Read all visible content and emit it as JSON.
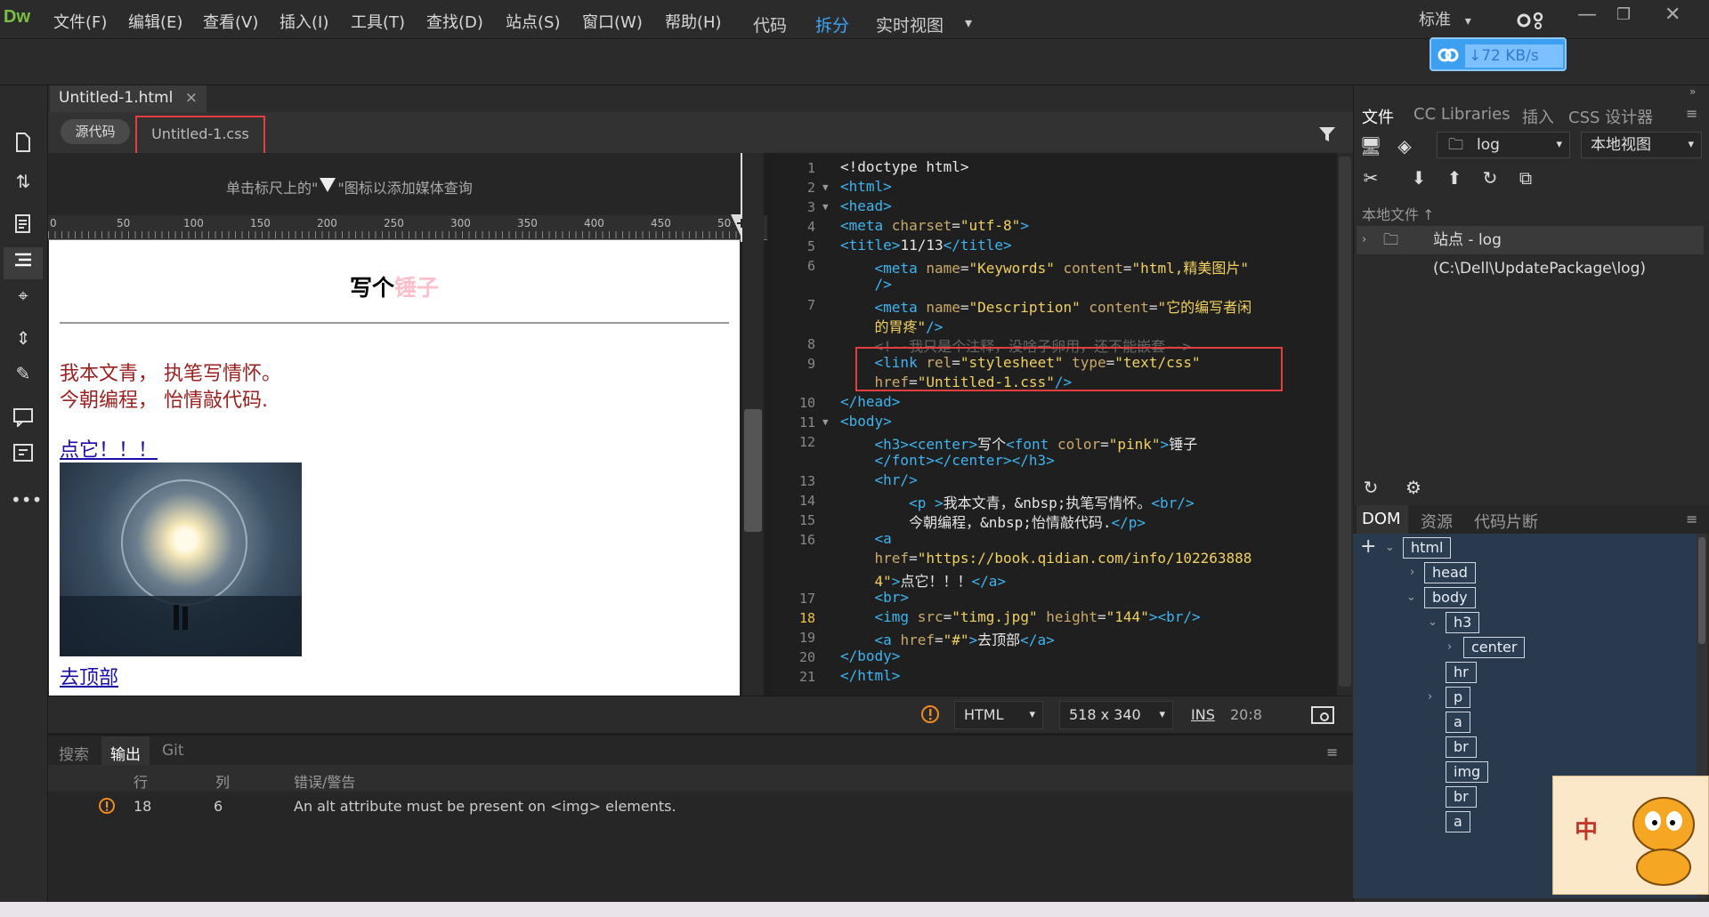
{
  "app": {
    "logo": "Dw",
    "workspace": "标准",
    "workspace_arrow": "▾"
  },
  "menu": [
    "文件(F)",
    "编辑(E)",
    "查看(V)",
    "插入(I)",
    "工具(T)",
    "查找(D)",
    "站点(S)",
    "窗口(W)",
    "帮助(H)"
  ],
  "viewbar": {
    "code": "代码",
    "split": "拆分",
    "live": "实时视图",
    "live_arrow": "▾"
  },
  "network": {
    "speed": "↓72 KB/s"
  },
  "document": {
    "tab": "Untitled-1.html",
    "source_btn": "源代码",
    "css_file": "Untitled-1.css"
  },
  "liveview": {
    "mq_hint_before": "单击标尺上的\"",
    "mq_hint_after": "\"图标以添加媒体查询",
    "ruler": [
      "0",
      "50",
      "100",
      "150",
      "200",
      "250",
      "300",
      "350",
      "400",
      "450",
      "50"
    ],
    "heading_black": "写个",
    "heading_pink": "锤子",
    "para1": "我本文青， 执笔写情怀。",
    "para2": "今朝编程， 怡情敲代码.",
    "link": "点它！！！",
    "bottom_link": "去顶部"
  },
  "code": {
    "lines": [
      {
        "n": "1",
        "fold": "",
        "html": "<span class='wt'>&lt;!doctype html&gt;</span>"
      },
      {
        "n": "2",
        "fold": "▼",
        "html": "<span class='tg'>&lt;html&gt;</span>"
      },
      {
        "n": "3",
        "fold": "▼",
        "html": "<span class='tg'>&lt;head&gt;</span>"
      },
      {
        "n": "4",
        "fold": "",
        "html": "<span class='tg'>&lt;meta </span><span class='at'>charset</span>=<span class='st'>\"utf-8\"</span><span class='tg'>&gt;</span>"
      },
      {
        "n": "5",
        "fold": "",
        "html": "<span class='tg'>&lt;title&gt;</span><span class='wt'>11/13</span><span class='tg'>&lt;/title&gt;</span>"
      }
    ]
  },
  "status": {
    "lang": "HTML",
    "size": "518 x 340",
    "ins": "INS",
    "pos": "20:8"
  },
  "output": {
    "tabs": [
      "搜索",
      "输出",
      "Git"
    ],
    "headers": [
      "行",
      "列",
      "错误/警告"
    ],
    "row": {
      "line": "18",
      "col": "6",
      "msg": "An alt attribute must be present on <img> elements."
    }
  },
  "right": {
    "tabs": [
      "文件",
      "CC Libraries",
      "插入",
      "CSS 设计器"
    ],
    "site_select": "log",
    "view_select": "本地视图",
    "local_files": "本地文件",
    "site_row": "站点 - log (C:\\Dell\\UpdatePackage\\log)",
    "dom_tabs": [
      "DOM",
      "资源",
      "代码片断"
    ],
    "dom_nodes": [
      "html",
      "head",
      "body",
      "h3",
      "center",
      "hr",
      "p",
      "a",
      "br",
      "img",
      "br",
      "a"
    ]
  },
  "mascot": {
    "text": "中"
  }
}
